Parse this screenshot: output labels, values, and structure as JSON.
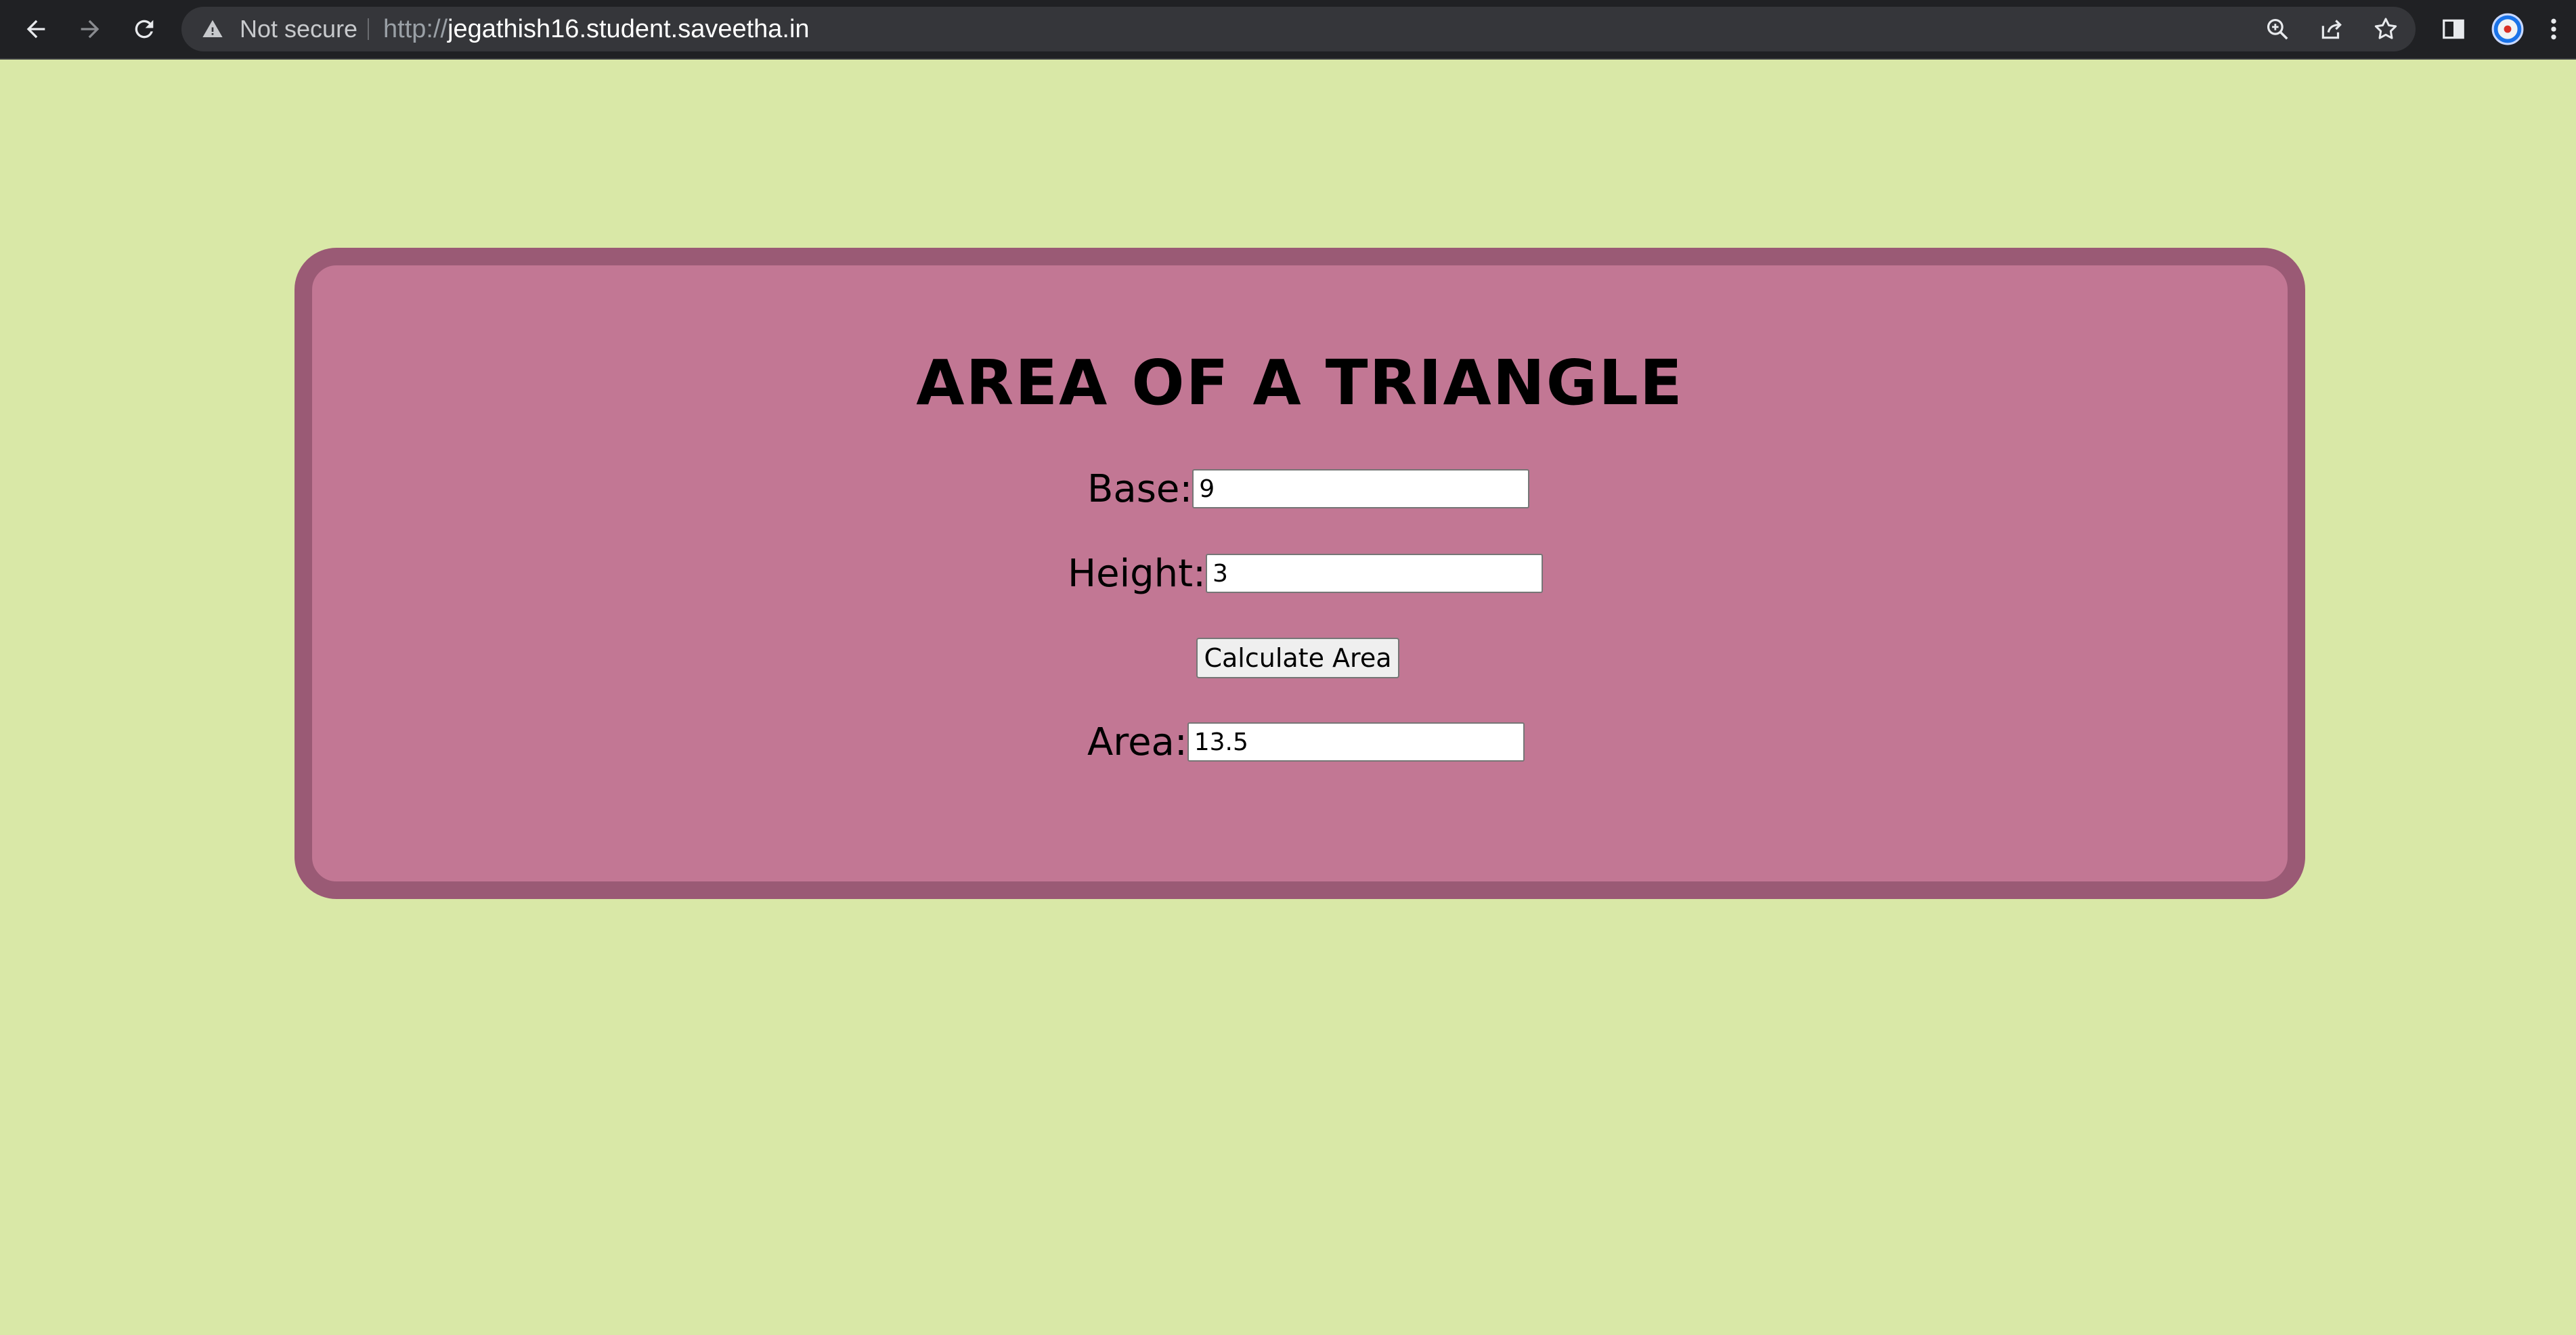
{
  "browser": {
    "security_label": "Not secure",
    "url_scheme": "http://",
    "url_host": "jegathish16.student.saveetha.in",
    "icons": [
      "back-arrow-icon",
      "forward-arrow-icon",
      "reload-icon",
      "warning-icon",
      "zoom-icon",
      "share-icon",
      "bookmark-star-icon",
      "side-panel-icon",
      "profile-avatar-icon",
      "more-menu-icon"
    ]
  },
  "page": {
    "title": "AREA OF A TRIANGLE",
    "base_label": "Base:",
    "base_value": "9",
    "height_label": "Height:",
    "height_value": "3",
    "button_label": "Calculate Area",
    "area_label": "Area:",
    "area_value": "13.5"
  },
  "colors": {
    "background": "#d9e8a7",
    "card_fill": "#c27794",
    "card_border": "#9a5a75",
    "toolbar": "#202124"
  }
}
